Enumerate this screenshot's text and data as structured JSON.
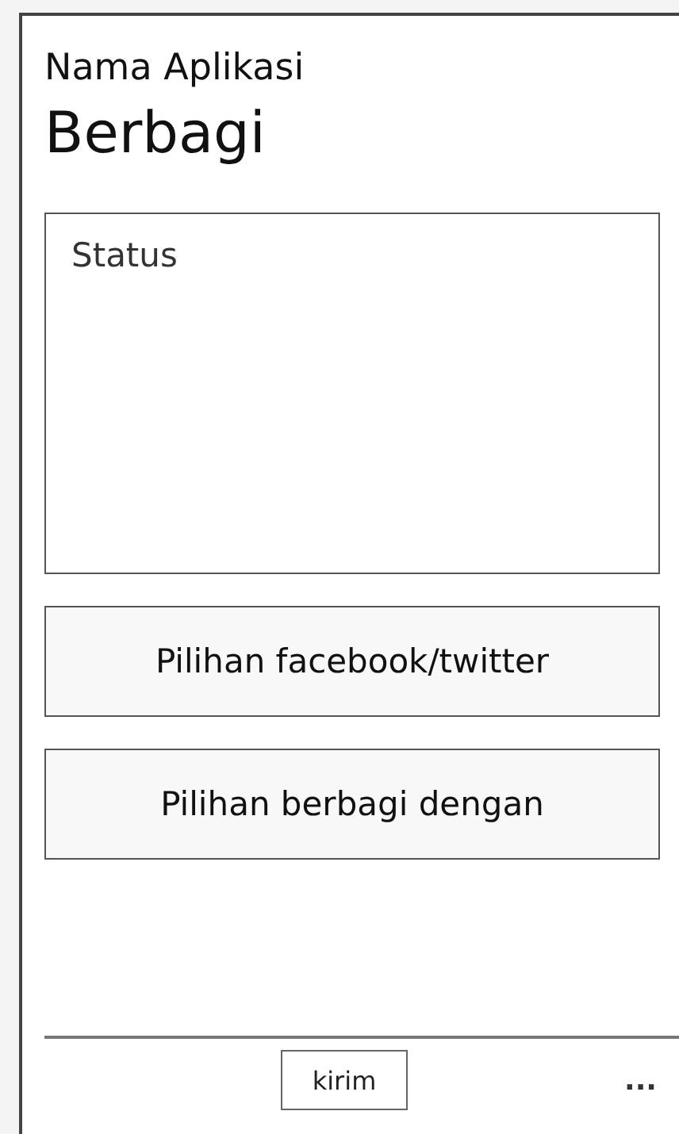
{
  "app_name": "Nama Aplikasi",
  "page_title": "Berbagi",
  "status_field": {
    "placeholder": "Status"
  },
  "options": [
    {
      "label": "Pilihan facebook/twitter"
    },
    {
      "label": "Pilihan berbagi dengan"
    }
  ],
  "app_bar": {
    "button": "kirim",
    "more": "..."
  }
}
